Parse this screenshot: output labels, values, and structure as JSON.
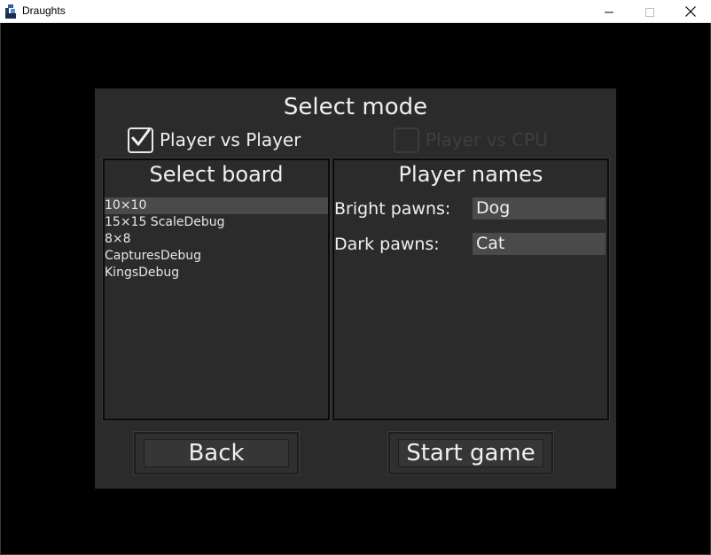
{
  "window": {
    "title": "Draughts",
    "controls": [
      "minimize-icon",
      "maximize-icon",
      "close-icon"
    ]
  },
  "dialog": {
    "title": "Select mode",
    "modes": [
      {
        "label": "Player vs Player",
        "checked": true,
        "enabled": true
      },
      {
        "label": "Player vs CPU",
        "checked": false,
        "enabled": false
      }
    ],
    "board_panel": {
      "title": "Select board",
      "boards": [
        "10×10",
        "15×15 ScaleDebug",
        "8×8",
        "CapturesDebug",
        "KingsDebug"
      ],
      "selected_index": 0
    },
    "names_panel": {
      "title": "Player names",
      "bright_label": "Bright pawns:",
      "bright_value": "Dog",
      "dark_label": "Dark pawns:",
      "dark_value": "Cat"
    },
    "buttons": {
      "back": "Back",
      "start": "Start game"
    }
  },
  "colors": {
    "background": "#000000",
    "dialog": "#2b2b2b",
    "selection": "#4a4a4a",
    "text": "#f0f0f0",
    "disabled_text": "#3f3f3f"
  }
}
